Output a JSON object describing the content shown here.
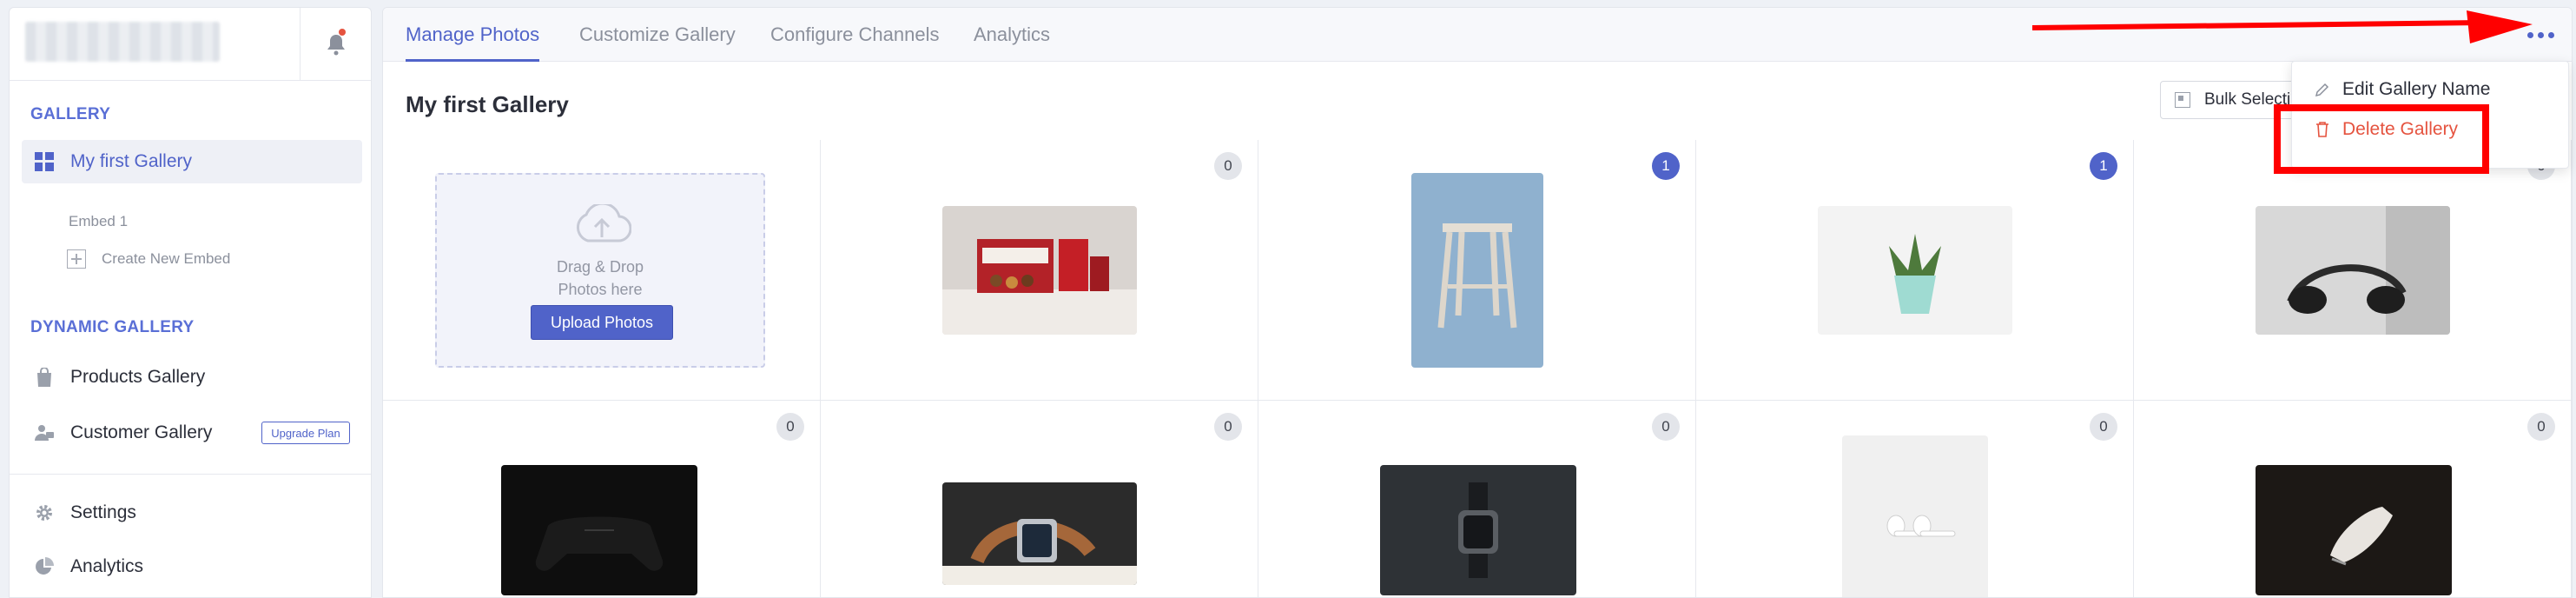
{
  "sidebar": {
    "sections": {
      "gallery": "GALLERY",
      "dynamic": "DYNAMIC GALLERY"
    },
    "items": {
      "my_first_gallery": "My first Gallery",
      "embed_1": "Embed 1",
      "create_new_embed": "Create New Embed",
      "products_gallery": "Products Gallery",
      "customer_gallery": "Customer Gallery",
      "upgrade_plan": "Upgrade Plan",
      "settings": "Settings",
      "analytics": "Analytics"
    }
  },
  "tabs": {
    "manage_photos": "Manage Photos",
    "customize_gallery": "Customize Gallery",
    "configure_channels": "Configure Channels",
    "analytics": "Analytics"
  },
  "main": {
    "title": "My first Gallery",
    "bulk_select": "Bulk Selection"
  },
  "upload": {
    "drag_line1": "Drag & Drop",
    "drag_line2": "Photos here",
    "button": "Upload Photos"
  },
  "photos": [
    {
      "count": "0",
      "selected": false,
      "subject": "timbits-box"
    },
    {
      "count": "1",
      "selected": true,
      "subject": "wooden-stool"
    },
    {
      "count": "1",
      "selected": true,
      "subject": "succulent-pot"
    },
    {
      "count": "0",
      "selected": false,
      "subject": "headphones-on-bed"
    },
    {
      "count": "0",
      "selected": false,
      "subject": "game-controller"
    },
    {
      "count": "0",
      "selected": false,
      "subject": "smartwatch-on-table"
    },
    {
      "count": "0",
      "selected": false,
      "subject": "smartwatch-dark"
    },
    {
      "count": "0",
      "selected": false,
      "subject": "earbuds"
    },
    {
      "count": "0",
      "selected": false,
      "subject": "sneaker-on-floor"
    }
  ],
  "menu": {
    "edit": "Edit Gallery Name",
    "delete": "Delete Gallery"
  },
  "colors": {
    "accent": "#5063c9",
    "danger": "#e5533f",
    "highlight": "#ff0000"
  }
}
